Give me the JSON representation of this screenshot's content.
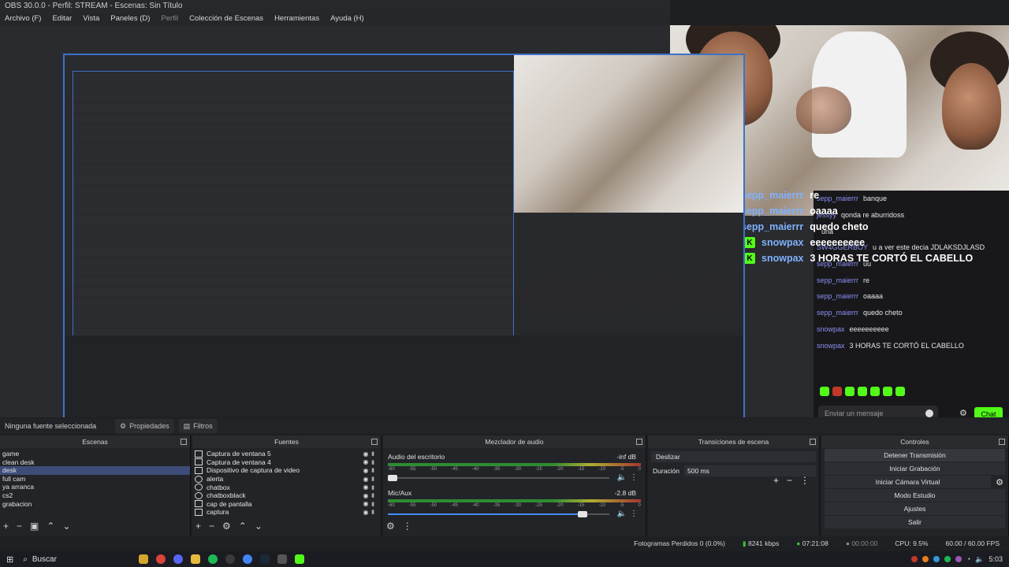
{
  "window": {
    "title": "OBS 30.0.0 - Perfil: STREAM - Escenas: Sin Título",
    "menu": [
      "Archivo (F)",
      "Editar",
      "Vista",
      "Paneles (D)",
      "Perfil",
      "Colección de Escenas",
      "Herramientas",
      "Ayuda (H)"
    ]
  },
  "chat": {
    "big_lines": [
      {
        "user": "sepp_maierrr",
        "message": "re"
      },
      {
        "user": "sepp_maierrr",
        "message": "oaaaa"
      },
      {
        "user": "sepp_maierrr",
        "message": "quedo cheto"
      },
      {
        "user": "snowpax",
        "message": "eeeeeeeeee"
      },
      {
        "user": "snowpax",
        "message": "3 HORAS TE CORTÓ EL CABELLO"
      }
    ],
    "lines": [
      {
        "user": "sepp_maierrr",
        "message": "banque"
      },
      {
        "user": "jessyy",
        "message": "qonda re aburridoss"
      },
      {
        "user": "",
        "message": "una"
      },
      {
        "user": "SW4GGERBOY",
        "message": "u a ver este decia JDLAKSDJLASD"
      },
      {
        "user": "sepp_maierrr",
        "message": "uu"
      },
      {
        "user": "sepp_maierrr",
        "message": "re"
      },
      {
        "user": "sepp_maierrr",
        "message": "oaaaa"
      },
      {
        "user": "sepp_maierrr",
        "message": "quedo cheto"
      },
      {
        "user": "snowpax",
        "message": "eeeeeeeeee"
      },
      {
        "user": "snowpax",
        "message": "3 HORAS TE CORTÓ EL CABELLO"
      }
    ],
    "input_placeholder": "Enviar un mensaje",
    "send_label": "Chat"
  },
  "sourcebar": {
    "no_source": "Ninguna fuente seleccionada",
    "properties": "Propiedades",
    "filters": "Filtros"
  },
  "docks": {
    "scenes": {
      "title": "Escenas",
      "items": [
        "game",
        "clean desk",
        "desk",
        "full cam",
        "ya arranca",
        "cs2",
        "grabacion"
      ],
      "selected": "desk"
    },
    "sources": {
      "title": "Fuentes",
      "items": [
        "Captura de ventana 5",
        "Captura de ventana 4",
        "Dispositivo de captura de video",
        "alerta",
        "chatbox",
        "chatboxblack",
        "cap de pantalla",
        "captura"
      ]
    },
    "mixer": {
      "title": "Mezclador de audio",
      "tracks": [
        {
          "name": "Audio del escritorio",
          "level": "-inf dB",
          "volume": 0.02
        },
        {
          "name": "Mic/Aux",
          "level": "-2.8 dB",
          "volume": 0.88
        }
      ],
      "ticks": [
        "-60",
        "-55",
        "-50",
        "-45",
        "-40",
        "-35",
        "-30",
        "-25",
        "-20",
        "-15",
        "-10",
        "-5",
        "0"
      ]
    },
    "transitions": {
      "title": "Transiciones de escena",
      "type": "Deslizar",
      "duration_label": "Duración",
      "duration_value": "500 ms"
    },
    "controls": {
      "title": "Controles",
      "buttons": [
        "Detener Transmisión",
        "Iniciar Grabación",
        "Iniciar Cámara Virtual",
        "Modo Estudio",
        "Ajustes",
        "Salir"
      ]
    }
  },
  "status": {
    "dropped": "Fotogramas Perdidos 0 (0.0%)",
    "bitrate": "8241 kbps",
    "live_time": "07:21:08",
    "rec_time": "00:00:00",
    "cpu": "CPU: 9.5%",
    "fps": "60.00 / 60.00 FPS"
  },
  "taskbar": {
    "search": "Buscar",
    "clock": "5:03"
  }
}
